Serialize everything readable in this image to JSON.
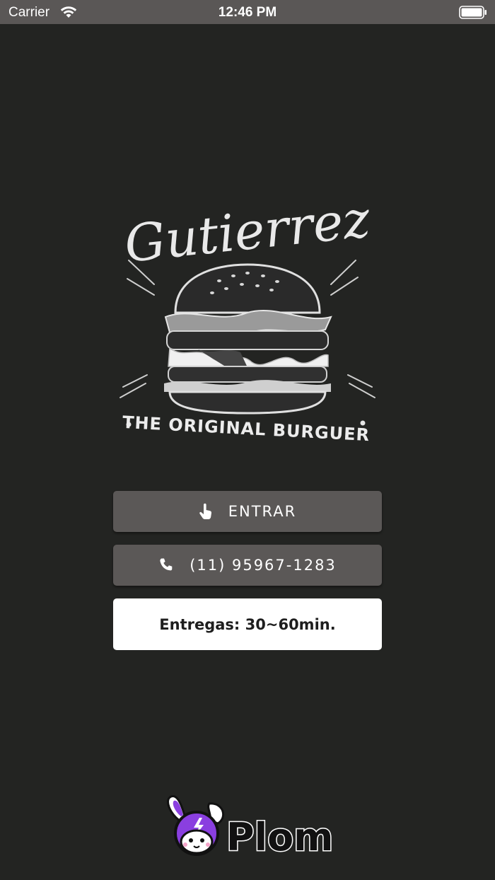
{
  "status_bar": {
    "carrier": "Carrier",
    "time": "12:46 PM",
    "icons": [
      "wifi-icon",
      "battery-icon"
    ]
  },
  "logo": {
    "brand_script": "Gutierrez",
    "tagline": "THE ORIGINAL BURGUER",
    "image": "burger-illustration"
  },
  "actions": {
    "enter_label": "ENTRAR",
    "enter_icon": "hand-pointer-icon",
    "phone_label": "(11) 95967-1283",
    "phone_icon": "phone-icon"
  },
  "delivery": {
    "text": "Entregas: 30~60min."
  },
  "footer": {
    "brand": "Plom",
    "colors": {
      "purple": "#8a3fe0",
      "black": "#111111"
    }
  },
  "theme": {
    "background": "#232422",
    "status_bar": "#5a5756",
    "button": "#5b5857",
    "badge": "#ffffff"
  }
}
